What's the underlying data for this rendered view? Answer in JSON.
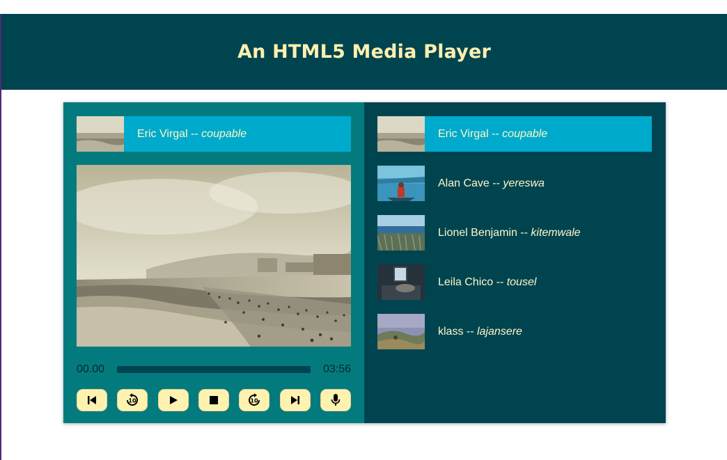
{
  "header": {
    "title": "An HTML5 Media Player"
  },
  "now_playing": {
    "artist": "Eric Virgal",
    "separator": " -- ",
    "title": "coupable"
  },
  "player": {
    "current_time": "00.00",
    "duration": "03:56",
    "progress": 0,
    "controls": [
      {
        "name": "previous-track-icon",
        "label": "previous"
      },
      {
        "name": "rewind-10-icon",
        "label": "rewind 10"
      },
      {
        "name": "play-icon",
        "label": "play"
      },
      {
        "name": "stop-icon",
        "label": "stop"
      },
      {
        "name": "forward-10-icon",
        "label": "forward 10"
      },
      {
        "name": "next-track-icon",
        "label": "next"
      },
      {
        "name": "microphone-icon",
        "label": "voice"
      }
    ]
  },
  "playlist": {
    "items": [
      {
        "artist": "Eric Virgal",
        "separator": " -- ",
        "title": "coupable",
        "active": true,
        "thumb": "beach"
      },
      {
        "artist": "Alan Cave",
        "separator": " -- ",
        "title": "yereswa",
        "active": false,
        "thumb": "kayak"
      },
      {
        "artist": "Lionel Benjamin",
        "separator": " -- ",
        "title": "kitemwale",
        "active": false,
        "thumb": "sea-grass"
      },
      {
        "artist": "Leila Chico",
        "separator": " -- ",
        "title": "tousel",
        "active": false,
        "thumb": "room"
      },
      {
        "artist": "klass",
        "separator": " -- ",
        "title": "lajansere",
        "active": false,
        "thumb": "hills"
      }
    ]
  },
  "colors": {
    "header_bg": "#004450",
    "title_text": "#fff0b0",
    "left_panel": "#037b7e",
    "accent": "#00aacc",
    "button_bg": "#fff2b0"
  }
}
